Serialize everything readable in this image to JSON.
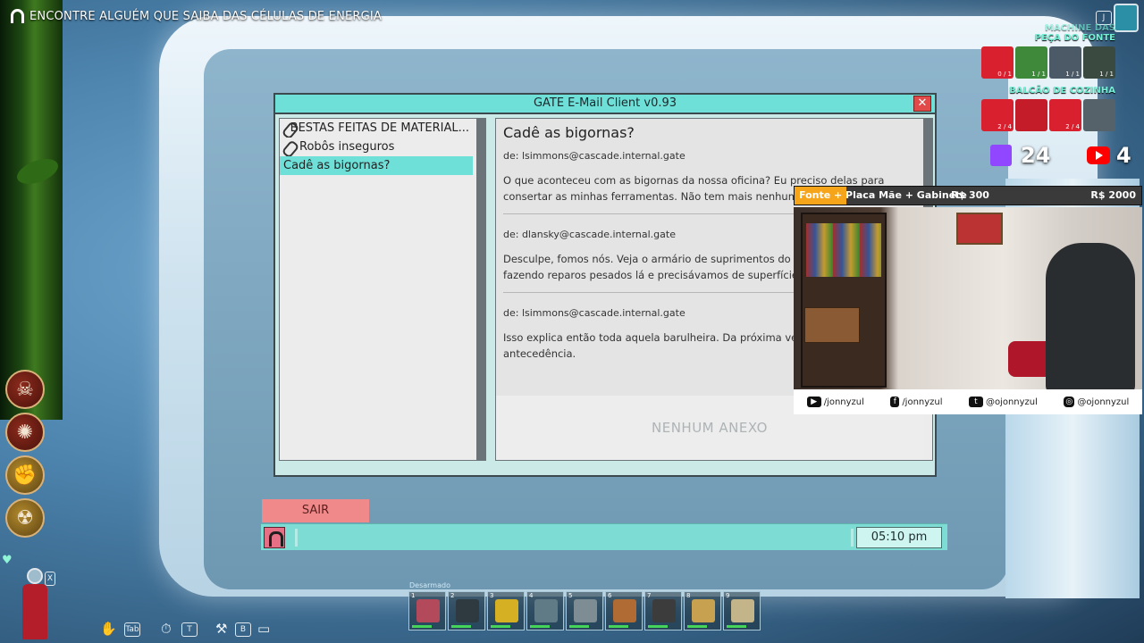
{
  "objective": {
    "text": "ENCONTRE ALGUÉM QUE SAIBA DAS CÉLULAS DE ENERGIA"
  },
  "mail_window": {
    "title": "GATE E-Mail Client v0.93",
    "close_symbol": "✕",
    "list": [
      {
        "label": "BESTAS FEITAS DE MATERIAL...",
        "has_attachment": true,
        "selected": false
      },
      {
        "label": "Robôs inseguros",
        "has_attachment": true,
        "selected": false
      },
      {
        "label": "Cadê as bigornas?",
        "has_attachment": false,
        "selected": true
      }
    ],
    "subject": "Cadê as bigornas?",
    "messages": [
      {
        "from": "de: lsimmons@cascade.internal.gate",
        "lines": [
          "O que aconteceu com as bigornas da nossa oficina? Eu preciso delas para",
          "consertar as minhas ferramentas. Não tem mais nenhuma"
        ]
      },
      {
        "from": "de: dlansky@cascade.internal.gate",
        "lines": [
          "Desculpe, fomos nós. Veja o armário de suprimentos do n",
          "fazendo reparos pesados lá e precisávamos de superfície"
        ]
      },
      {
        "from": "de: lsimmons@cascade.internal.gate",
        "lines": [
          "Isso explica então toda aquela barulheira. Da próxima ve",
          "antecedência."
        ]
      }
    ],
    "no_attachment": "NENHUM ANEXO"
  },
  "taskbar": {
    "exit_label": "SAIR",
    "clock": "05:10 pm"
  },
  "hud": {
    "keys": [
      "Tab",
      "T",
      "B"
    ],
    "close_key": "X",
    "j_key": "J",
    "hotbar_label": "Desarmado",
    "hotbar_slots": [
      {
        "num": "1",
        "color": "#b24a5c"
      },
      {
        "num": "2",
        "color": "#2f3a40"
      },
      {
        "num": "3",
        "color": "#d6b023"
      },
      {
        "num": "4",
        "color": "#607a86"
      },
      {
        "num": "5",
        "color": "#7e8d94"
      },
      {
        "num": "6",
        "color": "#b06a34"
      },
      {
        "num": "7",
        "color": "#3c3c3c"
      },
      {
        "num": "8",
        "color": "#c7a050"
      },
      {
        "num": "9",
        "color": "#c4b48a"
      }
    ]
  },
  "overlay": {
    "crafting_top_label": "MACHINE DAS",
    "crafting_title_1": "PEÇA DO FONTE",
    "crafting_title_2": "BALCÃO DE COZINHA",
    "row1_counts": [
      "0 / 1",
      "1 / 1",
      "1 / 1",
      "1 / 1"
    ],
    "row2_counts": [
      "2 / 4",
      "",
      "2 / 4",
      ""
    ],
    "twitch_count": "24",
    "youtube_count": "4",
    "goal_text": "Fonte + Placa Mãe + Gabinete",
    "goal_current": "R$ 300",
    "goal_target": "R$ 2000",
    "goal_progress": 0.15,
    "socials": [
      {
        "icon": "youtube-icon",
        "handle": "/jonnyzul"
      },
      {
        "icon": "facebook-icon",
        "handle": "/jonnyzul"
      },
      {
        "icon": "twitter-icon",
        "handle": "@ojonnyzul"
      },
      {
        "icon": "instagram-icon",
        "handle": "@ojonnyzul"
      }
    ]
  }
}
